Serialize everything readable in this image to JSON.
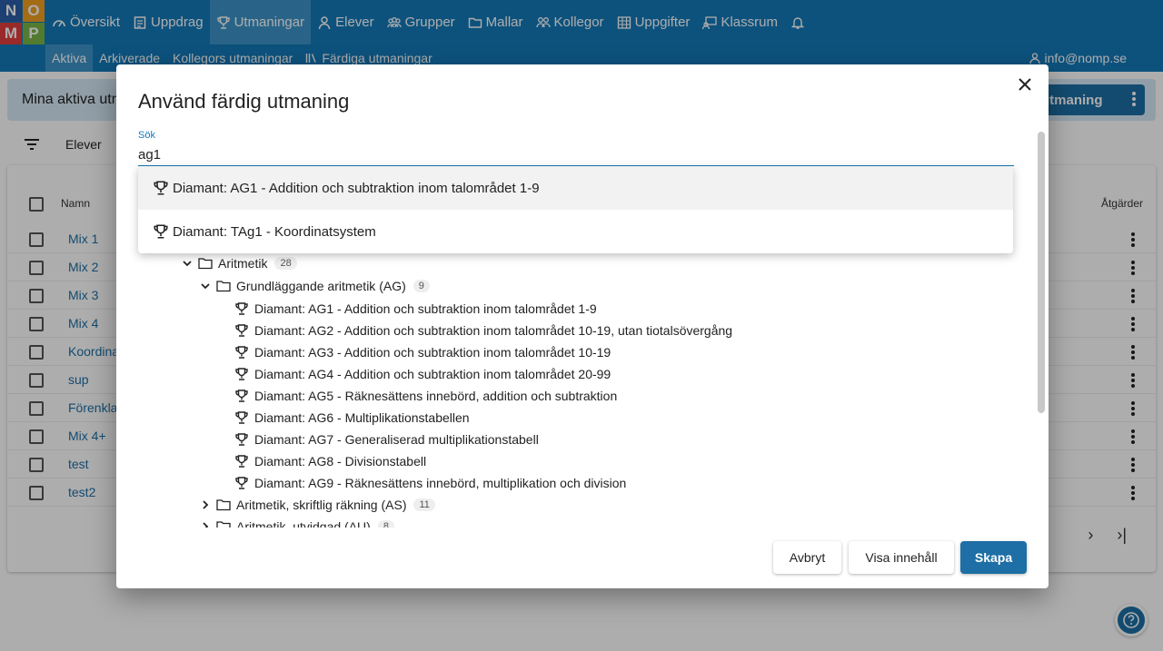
{
  "logo": {
    "letters": [
      "N",
      "O",
      "M",
      "P"
    ],
    "colors": [
      "#2b5ea7",
      "#f0a020",
      "#e33d3d",
      "#7ab648"
    ]
  },
  "nav": {
    "items": [
      {
        "label": "Översikt",
        "icon": "dashboard-icon"
      },
      {
        "label": "Uppdrag",
        "icon": "assignment-icon"
      },
      {
        "label": "Utmaningar",
        "icon": "trophy-icon",
        "active": true
      },
      {
        "label": "Elever",
        "icon": "person-icon"
      },
      {
        "label": "Grupper",
        "icon": "group-icon"
      },
      {
        "label": "Mallar",
        "icon": "folder-icon"
      },
      {
        "label": "Kollegor",
        "icon": "colleagues-icon"
      },
      {
        "label": "Uppgifter",
        "icon": "grid-icon"
      },
      {
        "label": "Klassrum",
        "icon": "classroom-icon"
      }
    ]
  },
  "subnav": {
    "items": [
      "Aktiva",
      "Arkiverade",
      "Kollegors utmaningar",
      "Färdiga utmaningar"
    ],
    "user": "info@nomp.se"
  },
  "page": {
    "title": "Mina aktiva utm",
    "create_label": "utmaning",
    "filter_label": "Elever",
    "col_name": "Namn",
    "col_actions": "Åtgärder",
    "rows": [
      "Mix 1",
      "Mix 2",
      "Mix 3",
      "Mix 4",
      "Koordina",
      "sup",
      "Förenkla",
      "Mix 4+",
      "test",
      "test2"
    ]
  },
  "modal": {
    "title": "Använd färdig utmaning",
    "search_label": "Sök",
    "search_value": "ag1",
    "suggestions": [
      "Diamant: AG1 - Addition och subtraktion inom talområdet 1-9",
      "Diamant: TAg1 - Koordinatsystem"
    ],
    "tree": {
      "root": {
        "label": "Aritmetik",
        "count": "28"
      },
      "group": {
        "label": "Grundläggande aritmetik (AG)",
        "count": "9"
      },
      "items": [
        "Diamant: AG1 - Addition och subtraktion inom talområdet 1-9",
        "Diamant: AG2 - Addition och subtraktion inom talområdet 10-19, utan tiotalsövergång",
        "Diamant: AG3 - Addition och subtraktion inom talområdet 10-19",
        "Diamant: AG4 - Addition och subtraktion inom talområdet 20-99",
        "Diamant: AG5 - Räknesättens innebörd, addition och subtraktion",
        "Diamant: AG6 - Multiplikationstabellen",
        "Diamant: AG7 - Generaliserad multiplikationstabell",
        "Diamant: AG8 - Divisionstabell",
        "Diamant: AG9 - Räknesättens innebörd, multiplikation och division"
      ],
      "collapsed": [
        {
          "label": "Aritmetik, skriftlig räkning (AS)",
          "count": "11"
        },
        {
          "label": "Aritmetik, utvidgad (AU)",
          "count": "8"
        }
      ]
    },
    "buttons": {
      "cancel": "Avbryt",
      "show": "Visa innehåll",
      "create": "Skapa"
    }
  }
}
